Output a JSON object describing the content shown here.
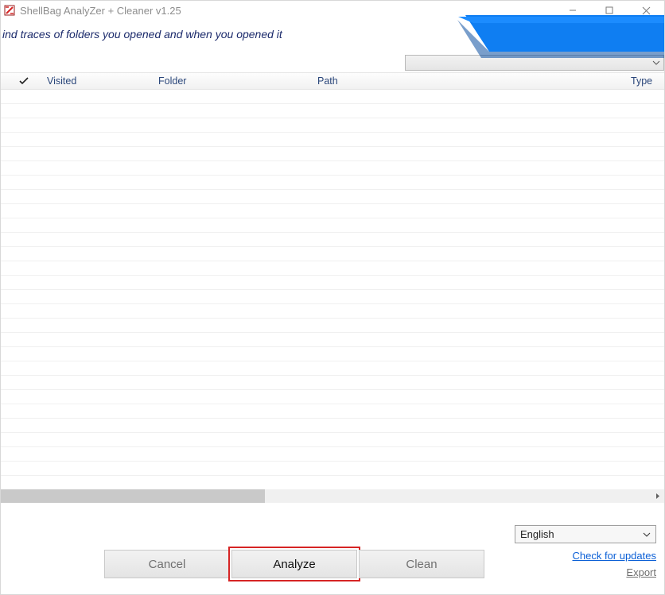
{
  "window": {
    "title": "ShellBag  AnalyZer + Cleaner v1.25"
  },
  "banner": {
    "tagline": "ind traces of folders you opened and when you opened it"
  },
  "filter": {
    "selected": ""
  },
  "columns": {
    "check": "✔",
    "visited": "Visited",
    "folder": "Folder",
    "path": "Path",
    "type": "Type"
  },
  "rows": [],
  "language": {
    "selected": "English"
  },
  "buttons": {
    "cancel": "Cancel",
    "analyze": "Analyze",
    "clean": "Clean"
  },
  "links": {
    "updates": "Check for updates",
    "export": "Export"
  }
}
